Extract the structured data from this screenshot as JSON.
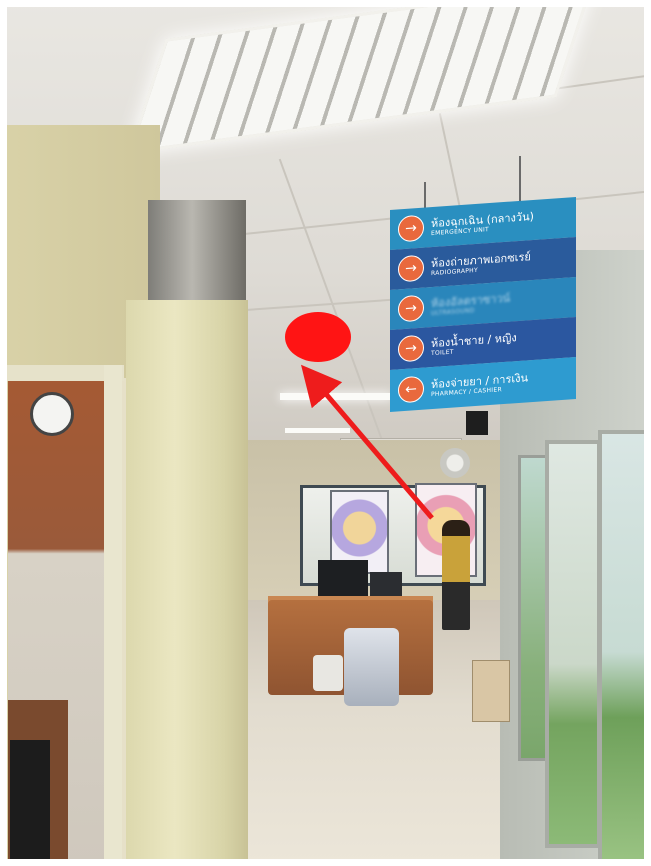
{
  "scene": {
    "description_label": "",
    "sign": {
      "rows": [
        {
          "thai": "ห้องฉุกเฉิน (กลางวัน)",
          "english": "EMERGENCY UNIT",
          "arrow": "→",
          "color": "#2a8fc0",
          "blurred": false
        },
        {
          "thai": "ห้องถ่ายภาพเอกซเรย์",
          "english": "RADIOGRAPHY",
          "arrow": "→",
          "color": "#2a5b9c",
          "blurred": false
        },
        {
          "thai": "ห้องอัลตราซาวน์",
          "english": "ULTRASOUND",
          "arrow": "→",
          "color": "#2a86bb",
          "blurred": true
        },
        {
          "thai": "ห้องน้ำชาย / หญิง",
          "english": "TOILET",
          "arrow": "→",
          "color": "#2b57a0",
          "blurred": false
        },
        {
          "thai": "ห้องจ่ายยา / การเงิน",
          "english": "PHARMACY / CASHIER",
          "arrow": "←",
          "color": "#2e9bd0",
          "blurred": false
        }
      ]
    },
    "annotation": {
      "marker_color": "#ff1414",
      "arrow_color": "#ee1c1c"
    }
  }
}
